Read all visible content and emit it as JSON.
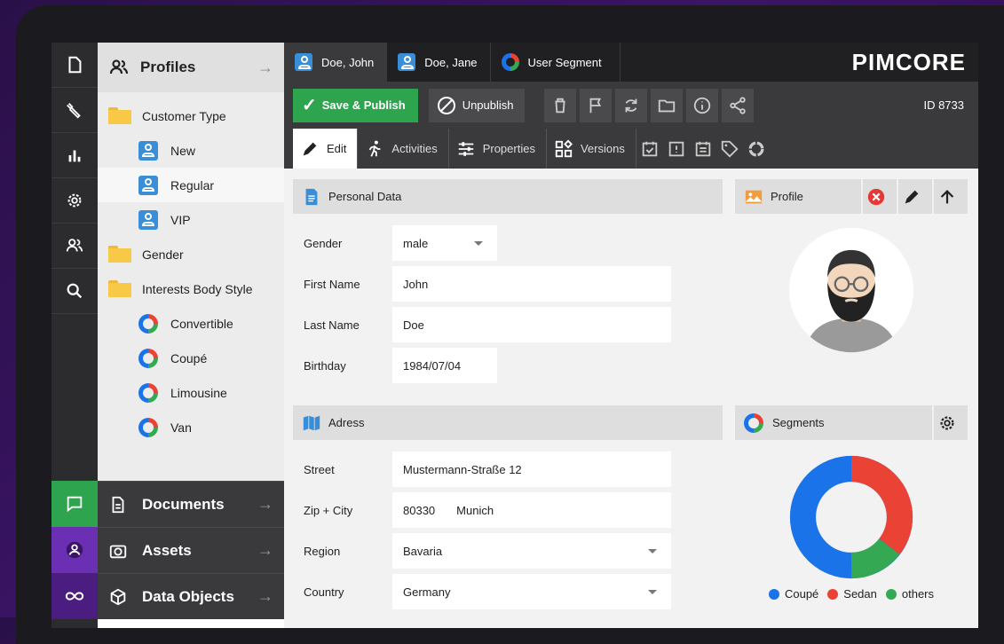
{
  "tree": {
    "title": "Profiles",
    "items": [
      {
        "label": "Customer Type"
      },
      {
        "label": "New"
      },
      {
        "label": "Regular"
      },
      {
        "label": "VIP"
      },
      {
        "label": "Gender"
      },
      {
        "label": "Interests Body Style"
      },
      {
        "label": "Convertible"
      },
      {
        "label": "Coupé"
      },
      {
        "label": "Limousine"
      },
      {
        "label": "Van"
      }
    ]
  },
  "bottom_nav": [
    {
      "label": "Documents"
    },
    {
      "label": "Assets"
    },
    {
      "label": "Data Objects"
    }
  ],
  "tabs": [
    {
      "label": "Doe, John"
    },
    {
      "label": "Doe, Jane"
    },
    {
      "label": "User Segment"
    }
  ],
  "logo": "PIMCORE",
  "toolbar": {
    "save_label": "Save & Publish",
    "unpublish_label": "Unpublish",
    "id_label": "ID 8733"
  },
  "subtabs": [
    {
      "label": "Edit"
    },
    {
      "label": "Activities"
    },
    {
      "label": "Properties"
    },
    {
      "label": "Versions"
    }
  ],
  "personal": {
    "title": "Personal Data",
    "fields": [
      {
        "label": "Gender",
        "value": "male"
      },
      {
        "label": "First Name",
        "value": "John"
      },
      {
        "label": "Last Name",
        "value": "Doe"
      },
      {
        "label": "Birthday",
        "value": "1984/07/04"
      }
    ]
  },
  "address": {
    "title": "Adress",
    "fields": [
      {
        "label": "Street",
        "value": "Mustermann-Straße 12"
      },
      {
        "label": "Zip + City",
        "zip": "80330",
        "city": "Munich"
      },
      {
        "label": "Region",
        "value": "Bavaria"
      },
      {
        "label": "Country",
        "value": "Germany"
      }
    ]
  },
  "profile_panel": {
    "title": "Profile"
  },
  "segments_panel": {
    "title": "Segments",
    "legend": [
      {
        "label": "Coupé",
        "color": "#1a73e8"
      },
      {
        "label": "Sedan",
        "color": "#ea4335"
      },
      {
        "label": "others",
        "color": "#34a853"
      }
    ]
  }
}
